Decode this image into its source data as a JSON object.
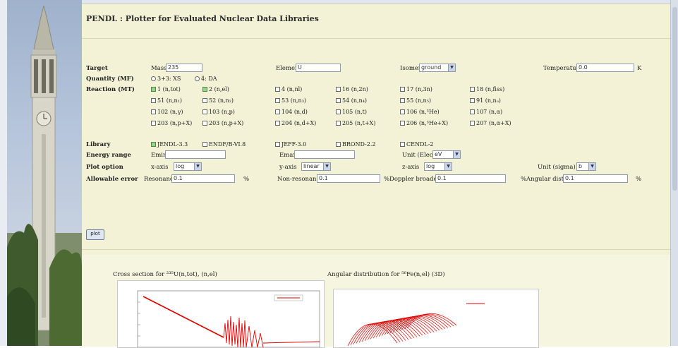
{
  "page": {
    "title": "PENDL : Plotter for Evaluated Nuclear Data Libraries"
  },
  "target": {
    "label": "Target",
    "mass_label": "Mass",
    "mass_value": "235",
    "element_label": "Element",
    "element_value": "U",
    "isomer_label": "Isomer",
    "isomer_value": "ground",
    "temperature_label": "Temperature",
    "temperature_value": "0.0",
    "temperature_unit": "K"
  },
  "quantity": {
    "label": "Quantity (MF)",
    "options": [
      "3+3: XS",
      "4: DA"
    ]
  },
  "reaction": {
    "label": "Reaction (MT)",
    "rows": [
      [
        {
          "t": "1 (n,tot)",
          "on": true
        },
        {
          "t": "2 (n,el)",
          "on": true
        },
        {
          "t": "4 (n,nl)",
          "on": false
        },
        {
          "t": "16 (n,2n)",
          "on": false
        },
        {
          "t": "17 (n,3n)",
          "on": false
        },
        {
          "t": "18 (n,fiss)",
          "on": false
        }
      ],
      [
        {
          "t": "51 (n,n₁)",
          "on": false
        },
        {
          "t": "52 (n,n₂)",
          "on": false
        },
        {
          "t": "53 (n,n₃)",
          "on": false
        },
        {
          "t": "54 (n,n₄)",
          "on": false
        },
        {
          "t": "55 (n,n₅)",
          "on": false
        },
        {
          "t": "91 (n,nₒ)",
          "on": false
        }
      ],
      [
        {
          "t": "102 (n,γ)",
          "on": false
        },
        {
          "t": "103 (n,p)",
          "on": false
        },
        {
          "t": "104 (n,d)",
          "on": false
        },
        {
          "t": "105 (n,t)",
          "on": false
        },
        {
          "t": "106 (n,³He)",
          "on": false
        },
        {
          "t": "107 (n,α)",
          "on": false
        }
      ],
      [
        {
          "t": "203 (n,p+X)",
          "on": false
        },
        {
          "t": "203 (n,p+X)",
          "on": false
        },
        {
          "t": "204 (n,d+X)",
          "on": false
        },
        {
          "t": "205 (n,t+X)",
          "on": false
        },
        {
          "t": "206 (n,³He+X)",
          "on": false
        },
        {
          "t": "207 (n,α+X)",
          "on": false
        }
      ]
    ]
  },
  "library": {
    "label": "Library",
    "items": [
      {
        "t": "JENDL-3.3",
        "on": true
      },
      {
        "t": "ENDF/B-VI.8",
        "on": false
      },
      {
        "t": "JEFF-3.0",
        "on": false
      },
      {
        "t": "BROND-2.2",
        "on": false
      },
      {
        "t": "CENDL-2",
        "on": false
      }
    ]
  },
  "energy": {
    "label": "Energy range",
    "emin_label": "Emin",
    "emax_label": "Emax",
    "unit_label": "Unit (Elec)",
    "unit_value": "eV"
  },
  "plot_option": {
    "label": "Plot option",
    "xaxis_label": "x-axis",
    "xaxis_value": "log",
    "yaxis_label": "y-axis",
    "yaxis_value": "linear",
    "zaxis_label": "z-axis",
    "zaxis_value": "log",
    "unit_sigma_label": "Unit (sigma)",
    "unit_sigma_value": "b"
  },
  "allowable": {
    "label": "Allowable error",
    "resonance_label": "Resonance",
    "resonance_value": "0.1",
    "nonres_label": "Non-resonance",
    "nonres_value": "0.1",
    "doppler_label": "Doppler broaden",
    "doppler_value": "0.1",
    "angular_label": "Angular dist",
    "angular_value": "0.1",
    "percent": "%"
  },
  "actions": {
    "plot_button": "plot"
  },
  "plots": {
    "left_caption": "Cross section for ²³⁵U(n,tot), (n,el)",
    "right_caption": "Angular distribution for ⁵⁶Fe(n,el) (3D)"
  },
  "colors": {
    "panel_bg": "#f3f2d6",
    "curve": "#e00000",
    "checked": "#9bd08d"
  }
}
